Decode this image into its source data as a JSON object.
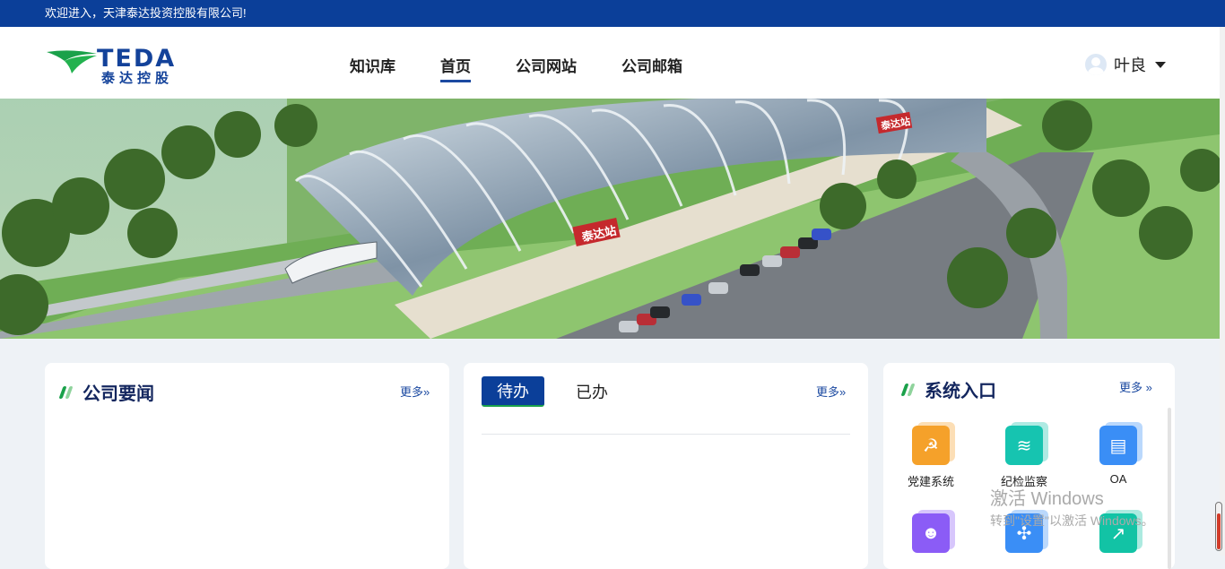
{
  "topbar": {
    "welcome": "欢迎进入，天津泰达投资控股有限公司!"
  },
  "header": {
    "logo_brand": "TEDA",
    "logo_cn": "泰达控股",
    "nav": [
      {
        "label": "知识库"
      },
      {
        "label": "首页"
      },
      {
        "label": "公司网站"
      },
      {
        "label": "公司邮箱"
      }
    ],
    "user_name": "叶良"
  },
  "banner": {
    "station_sign": "泰达站",
    "station_sign2": "泰达站"
  },
  "news_card": {
    "title": "公司要闻",
    "more": "更多»"
  },
  "todo_card": {
    "tab_todo": "待办",
    "tab_done": "已办",
    "more": "更多»"
  },
  "system_card": {
    "title": "系统入口",
    "more": "更多 »",
    "items": [
      {
        "label": "党建系统",
        "icon": "party-icon",
        "color": "#f5a12a"
      },
      {
        "label": "纪检监察",
        "icon": "layers-icon",
        "color": "#16c4b0"
      },
      {
        "label": "OA",
        "icon": "document-icon",
        "color": "#3a8ef6"
      },
      {
        "label": "",
        "icon": "person-icon",
        "color": "#8b5cf6"
      },
      {
        "label": "",
        "icon": "network-icon",
        "color": "#3a8ef6"
      },
      {
        "label": "",
        "icon": "chart-icon",
        "color": "#12c3a5"
      }
    ]
  },
  "watermark": {
    "line1": "激活 Windows",
    "line2": "转到\"设置\"以激活 Windows。"
  }
}
